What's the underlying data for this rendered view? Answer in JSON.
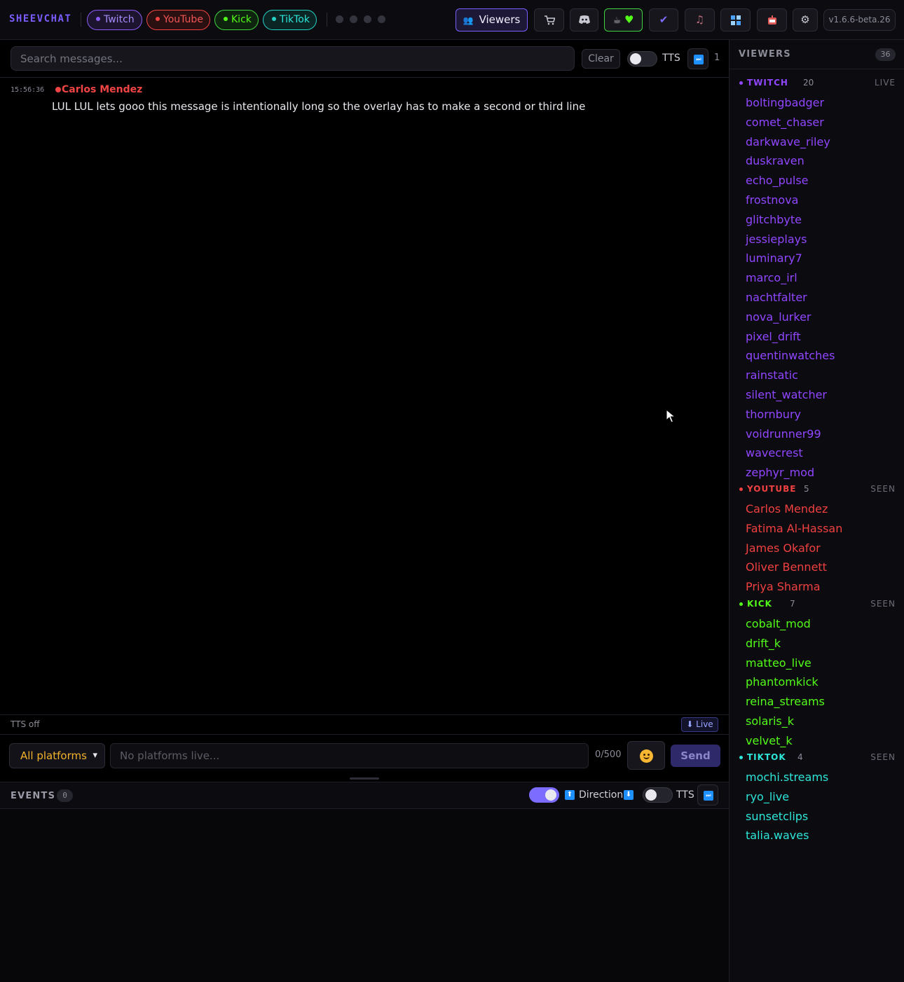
{
  "brand": "SHEEVCHAT",
  "platforms": [
    {
      "label": "Twitch",
      "color": "#9146ff"
    },
    {
      "label": "YouTube",
      "color": "#f04040"
    },
    {
      "label": "Kick",
      "color": "#53fc18"
    },
    {
      "label": "TikTok",
      "color": "#2ee6d9"
    }
  ],
  "toolbar": {
    "viewers_label": "Viewers",
    "version": "v1.6.6-beta.26",
    "icons": [
      "viewers-icon",
      "cart-icon",
      "discord-icon",
      "heart-icon",
      "check-icon",
      "music-icon",
      "grid-icon",
      "bot-icon",
      "gear-icon"
    ]
  },
  "search": {
    "placeholder": "Search messages...",
    "clear_label": "Clear",
    "tts_label": "TTS",
    "queue_count": "1"
  },
  "messages": [
    {
      "time": "15:56:36",
      "author": "Carlos Mendez",
      "platform_color": "#f04040",
      "text": "LUL LUL lets gooo this message is intentionally long so the overlay has to make a second or third line"
    }
  ],
  "status": {
    "tts": "TTS off",
    "live_label": "⬇ Live"
  },
  "composer": {
    "platform_select": "All platforms",
    "placeholder": "No platforms live...",
    "char_count": "0/500",
    "send_label": "Send"
  },
  "events": {
    "title": "EVENTS",
    "count": "0",
    "direction_label": "Direction",
    "tts_label": "TTS"
  },
  "viewers": {
    "title": "VIEWERS",
    "total": "36",
    "sections": [
      {
        "name": "TWITCH",
        "count": "20",
        "status": "LIVE",
        "users": [
          "boltingbadger",
          "comet_chaser",
          "darkwave_riley",
          "duskraven",
          "echo_pulse",
          "frostnova",
          "glitchbyte",
          "jessieplays",
          "luminary7",
          "marco_irl",
          "nachtfalter",
          "nova_lurker",
          "pixel_drift",
          "quentinwatches",
          "rainstatic",
          "silent_watcher",
          "thornbury",
          "voidrunner99",
          "wavecrest",
          "zephyr_mod"
        ]
      },
      {
        "name": "YOUTUBE",
        "count": "5",
        "status": "SEEN",
        "users": [
          "Carlos Mendez",
          "Fatima Al-Hassan",
          "James Okafor",
          "Oliver Bennett",
          "Priya Sharma"
        ]
      },
      {
        "name": "KICK",
        "count": "7",
        "status": "SEEN",
        "users": [
          "cobalt_mod",
          "drift_k",
          "matteo_live",
          "phantomkick",
          "reina_streams",
          "solaris_k",
          "velvet_k"
        ]
      },
      {
        "name": "TIKTOK",
        "count": "4",
        "status": "SEEN",
        "users": [
          "mochi.streams",
          "ryo_live",
          "sunsetclips",
          "talia.waves"
        ]
      }
    ]
  }
}
